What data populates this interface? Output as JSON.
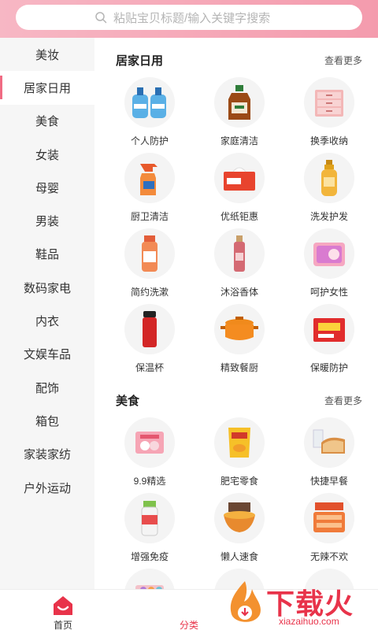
{
  "search": {
    "placeholder": "粘贴宝贝标题/输入关键字搜索"
  },
  "sidebar": {
    "items": [
      {
        "label": "美妆"
      },
      {
        "label": "居家日用"
      },
      {
        "label": "美食"
      },
      {
        "label": "女装"
      },
      {
        "label": "母婴"
      },
      {
        "label": "男装"
      },
      {
        "label": "鞋品"
      },
      {
        "label": "数码家电"
      },
      {
        "label": "内衣"
      },
      {
        "label": "文娱车品"
      },
      {
        "label": "配饰"
      },
      {
        "label": "箱包"
      },
      {
        "label": "家装家纺"
      },
      {
        "label": "户外运动"
      }
    ],
    "active_index": 1
  },
  "sections": [
    {
      "title": "居家日用",
      "more": "查看更多",
      "items": [
        {
          "label": "个人防护",
          "icon": "hand-sanitizer-icon"
        },
        {
          "label": "家庭清洁",
          "icon": "disinfectant-bottle-icon"
        },
        {
          "label": "换季收纳",
          "icon": "storage-drawer-icon"
        },
        {
          "label": "厨卫清洁",
          "icon": "spray-bottle-icon"
        },
        {
          "label": "优纸钜惠",
          "icon": "tissue-box-icon"
        },
        {
          "label": "洗发护发",
          "icon": "shampoo-bottle-icon"
        },
        {
          "label": "简约洗漱",
          "icon": "mouthwash-icon"
        },
        {
          "label": "沐浴香体",
          "icon": "body-mist-icon"
        },
        {
          "label": "呵护女性",
          "icon": "sanitary-pad-icon"
        },
        {
          "label": "保温杯",
          "icon": "thermos-cup-icon"
        },
        {
          "label": "精致餐厨",
          "icon": "cooking-pot-icon"
        },
        {
          "label": "保暖防护",
          "icon": "heat-pack-icon"
        }
      ]
    },
    {
      "title": "美食",
      "more": "查看更多",
      "items": [
        {
          "label": "9.9精选",
          "icon": "snack-pack-icon"
        },
        {
          "label": "肥宅零食",
          "icon": "chips-bag-icon"
        },
        {
          "label": "快捷早餐",
          "icon": "bread-milk-icon"
        },
        {
          "label": "增强免疫",
          "icon": "supplement-bottle-icon"
        },
        {
          "label": "懒人速食",
          "icon": "noodle-bowl-icon"
        },
        {
          "label": "无辣不欢",
          "icon": "spicy-snack-icon"
        }
      ]
    }
  ],
  "tabbar": {
    "home_label": "首页",
    "category_label": "分类"
  },
  "watermark": {
    "title": "下载火",
    "domain": "xiazaihuo.com"
  },
  "colors": {
    "accent": "#e8334a",
    "header_start": "#f7b7c4",
    "header_end": "#f49bad"
  }
}
